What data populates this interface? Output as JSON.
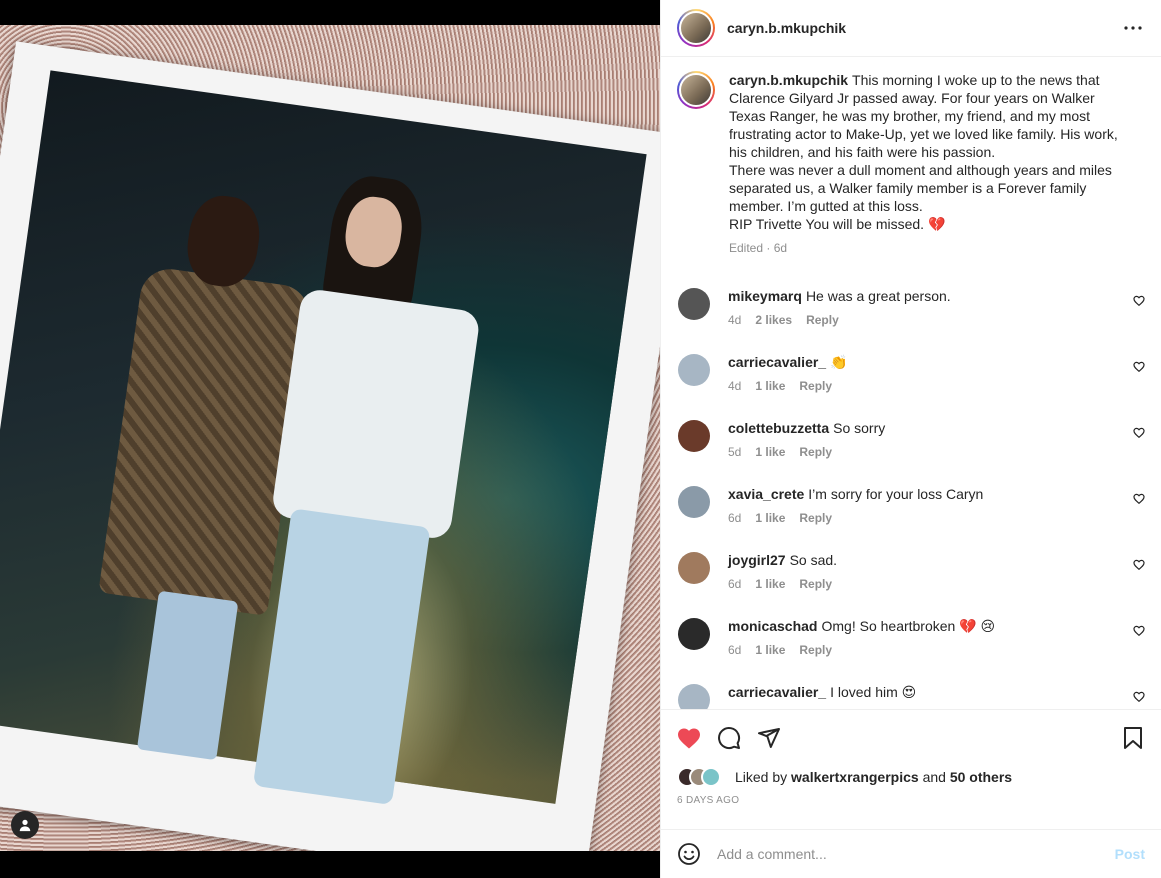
{
  "post": {
    "username": "caryn.b.mkupchik",
    "caption": "This morning I woke up to the news that Clarence Gilyard Jr passed away. For four years on Walker Texas Ranger, he was my brother, my friend, and my most frustrating actor to Make-Up, yet we loved like family. His work, his children, and his faith were his passion.\nThere was never a dull moment and although years and miles separated us, a Walker family member is a Forever family member. I’m gutted at this loss.\nRIP Trivette You will be missed. 💔",
    "caption_meta": "Edited · 6d"
  },
  "comments": [
    {
      "user": "mikeymarq",
      "text": "He was a great person.",
      "age": "4d",
      "likes": "2 likes",
      "reply": "Reply",
      "avatar_color": "#555555"
    },
    {
      "user": "carriecavalier_",
      "text": "👏",
      "age": "4d",
      "likes": "1 like",
      "reply": "Reply",
      "avatar_color": "#a7b6c4"
    },
    {
      "user": "colettebuzzetta",
      "text": "So sorry",
      "age": "5d",
      "likes": "1 like",
      "reply": "Reply",
      "avatar_color": "#6a3a2a"
    },
    {
      "user": "xavia_crete",
      "text": "I’m sorry for your loss Caryn",
      "age": "6d",
      "likes": "1 like",
      "reply": "Reply",
      "avatar_color": "#8a9aa8"
    },
    {
      "user": "joygirl27",
      "text": "So sad.",
      "age": "6d",
      "likes": "1 like",
      "reply": "Reply",
      "avatar_color": "#a07a5e"
    },
    {
      "user": "monicaschad",
      "text": "Omg! So heartbroken 💔 😢",
      "age": "6d",
      "likes": "1 like",
      "reply": "Reply",
      "avatar_color": "#2a2a2a"
    },
    {
      "user": "carriecavalier_",
      "text": "I loved him 😍",
      "age": "",
      "likes": "",
      "reply": "",
      "avatar_color": "#a7b6c4"
    }
  ],
  "likes": {
    "prefix": "Liked by",
    "user": "walkertxrangerpics",
    "middle": "and",
    "others": "50 others"
  },
  "timestamp": "6 DAYS AGO",
  "add_comment": {
    "placeholder": "Add a comment...",
    "post_label": "Post"
  },
  "icons": {
    "like": "heart-filled-icon",
    "comment": "comment-icon",
    "share": "share-icon",
    "save": "bookmark-icon",
    "more": "more-horizontal-icon",
    "emoji": "emoji-icon"
  },
  "colors": {
    "like_red": "#ed4956",
    "post_disabled": "#b2dffc",
    "muted": "#8e8e8e"
  }
}
